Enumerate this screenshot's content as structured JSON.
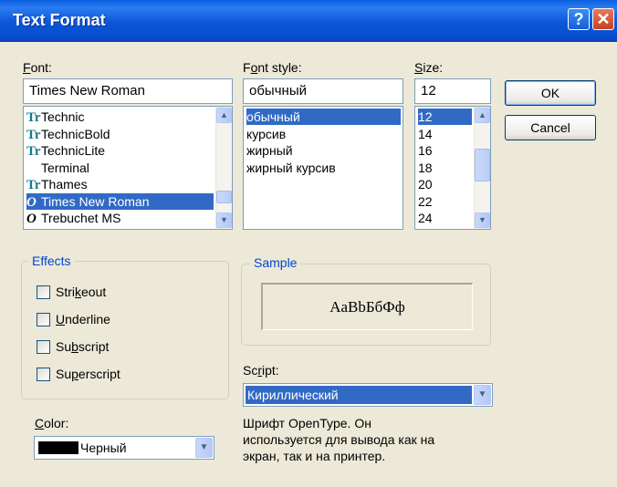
{
  "window": {
    "title": "Text Format",
    "help_glyph": "?",
    "close_glyph": "✕"
  },
  "font": {
    "label": "Font:",
    "label_key": "F",
    "label_rest": "ont:",
    "value": "Times New Roman",
    "items": [
      {
        "label": "Technic",
        "icon": "truetype-icon",
        "glyph": "Tr"
      },
      {
        "label": "TechnicBold",
        "icon": "truetype-icon",
        "glyph": "Tr"
      },
      {
        "label": "TechnicLite",
        "icon": "truetype-icon",
        "glyph": "Tr"
      },
      {
        "label": "Terminal",
        "icon": "",
        "glyph": ""
      },
      {
        "label": "Thames",
        "icon": "truetype-icon",
        "glyph": "Tr"
      },
      {
        "label": "Times New Roman",
        "icon": "opentype-icon",
        "glyph": "O",
        "selected": true
      },
      {
        "label": "Trebuchet MS",
        "icon": "opentype-icon",
        "glyph": "O"
      }
    ]
  },
  "style": {
    "label": "Font style:",
    "label_pre": "F",
    "label_key": "o",
    "label_rest": "nt style:",
    "value": "обычный",
    "items": [
      "обычный",
      "курсив",
      "жирный",
      "жирный курсив"
    ],
    "selected_index": 0
  },
  "size": {
    "label": "Size:",
    "label_key": "S",
    "label_rest": "ize:",
    "value": "12",
    "items": [
      "12",
      "14",
      "16",
      "18",
      "20",
      "22",
      "24"
    ],
    "selected_index": 0
  },
  "buttons": {
    "ok": "OK",
    "cancel": "Cancel"
  },
  "effects": {
    "title": "Effects",
    "strikeout": {
      "pre": "Stri",
      "key": "k",
      "rest": "eout",
      "checked": false
    },
    "underline": {
      "pre": "",
      "key": "U",
      "rest": "nderline",
      "checked": false
    },
    "subscript": {
      "pre": "Su",
      "key": "b",
      "rest": "script",
      "checked": false
    },
    "superscript": {
      "pre": "Su",
      "key": "p",
      "rest": "erscript",
      "checked": false
    }
  },
  "color": {
    "label_key": "C",
    "label_rest": "olor:",
    "value": "Черный",
    "swatch": "#000000"
  },
  "sample": {
    "title": "Sample",
    "text": "AaBbБбФф"
  },
  "script": {
    "label_pre": "Sc",
    "label_key": "r",
    "label_rest": "ipt:",
    "value": "Кириллический"
  },
  "description": {
    "line1": "Шрифт OpenType. Он",
    "line2": "используется для вывода как на",
    "line3": "экран, так и на принтер."
  }
}
